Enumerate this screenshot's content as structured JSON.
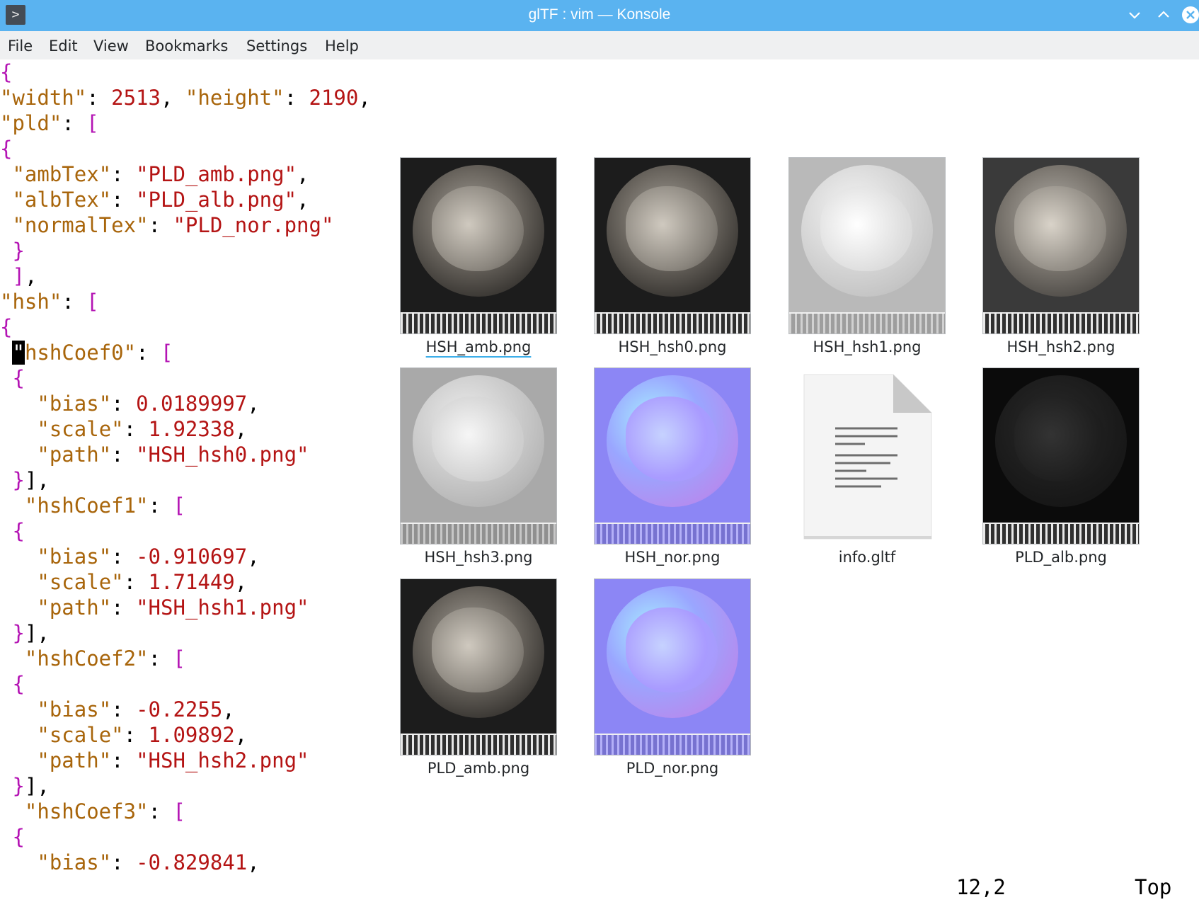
{
  "window": {
    "title": "glTF : vim — Konsole",
    "app_icon": ">",
    "buttons": [
      "minimize-icon",
      "maximize-icon",
      "close-icon"
    ]
  },
  "menu": {
    "items": [
      "File",
      "Edit",
      "View",
      "Bookmarks",
      "Settings",
      "Help"
    ]
  },
  "editor": {
    "lines": [
      [
        [
          "p",
          "{"
        ]
      ],
      [
        [
          "k",
          "\"width\""
        ],
        [
          "t",
          ": "
        ],
        [
          "n",
          "2513"
        ],
        [
          "t",
          ", "
        ],
        [
          "k",
          "\"height\""
        ],
        [
          "t",
          ": "
        ],
        [
          "n",
          "2190"
        ],
        [
          "t",
          ","
        ]
      ],
      [
        [
          "k",
          "\"pld\""
        ],
        [
          "t",
          ": "
        ],
        [
          "p",
          "["
        ]
      ],
      [
        [
          "p",
          "{"
        ]
      ],
      [
        [
          "t",
          " "
        ],
        [
          "k",
          "\"ambTex\""
        ],
        [
          "t",
          ": "
        ],
        [
          "s",
          "\"PLD_amb.png\""
        ],
        [
          "t",
          ","
        ]
      ],
      [
        [
          "t",
          " "
        ],
        [
          "k",
          "\"albTex\""
        ],
        [
          "t",
          ": "
        ],
        [
          "s",
          "\"PLD_alb.png\""
        ],
        [
          "t",
          ","
        ]
      ],
      [
        [
          "t",
          " "
        ],
        [
          "k",
          "\"normalTex\""
        ],
        [
          "t",
          ": "
        ],
        [
          "s",
          "\"PLD_nor.png\""
        ]
      ],
      [
        [
          "t",
          " "
        ],
        [
          "p",
          "}"
        ]
      ],
      [
        [
          "t",
          " "
        ],
        [
          "p",
          "]"
        ],
        [
          "t",
          ","
        ]
      ],
      [
        [
          "k",
          "\"hsh\""
        ],
        [
          "t",
          ": "
        ],
        [
          "p",
          "["
        ]
      ],
      [
        [
          "p",
          "{"
        ]
      ],
      [
        [
          "t",
          " "
        ],
        [
          "c",
          "\""
        ],
        [
          "k",
          "hshCoef0\""
        ],
        [
          "t",
          ": "
        ],
        [
          "p",
          "["
        ]
      ],
      [
        [
          "t",
          " "
        ],
        [
          "p",
          "{"
        ]
      ],
      [
        [
          "t",
          "   "
        ],
        [
          "k",
          "\"bias\""
        ],
        [
          "t",
          ": "
        ],
        [
          "n",
          "0.0189997"
        ],
        [
          "t",
          ","
        ]
      ],
      [
        [
          "t",
          "   "
        ],
        [
          "k",
          "\"scale\""
        ],
        [
          "t",
          ": "
        ],
        [
          "n",
          "1.92338"
        ],
        [
          "t",
          ","
        ]
      ],
      [
        [
          "t",
          "   "
        ],
        [
          "k",
          "\"path\""
        ],
        [
          "t",
          ": "
        ],
        [
          "s",
          "\"HSH_hsh0.png\""
        ]
      ],
      [
        [
          "t",
          " "
        ],
        [
          "p",
          "}"
        ],
        [
          "t",
          "],"
        ]
      ],
      [
        [
          "t",
          "  "
        ],
        [
          "k",
          "\"hshCoef1\""
        ],
        [
          "t",
          ": "
        ],
        [
          "p",
          "["
        ]
      ],
      [
        [
          "t",
          " "
        ],
        [
          "p",
          "{"
        ]
      ],
      [
        [
          "t",
          "   "
        ],
        [
          "k",
          "\"bias\""
        ],
        [
          "t",
          ": "
        ],
        [
          "n",
          "-0.910697"
        ],
        [
          "t",
          ","
        ]
      ],
      [
        [
          "t",
          "   "
        ],
        [
          "k",
          "\"scale\""
        ],
        [
          "t",
          ": "
        ],
        [
          "n",
          "1.71449"
        ],
        [
          "t",
          ","
        ]
      ],
      [
        [
          "t",
          "   "
        ],
        [
          "k",
          "\"path\""
        ],
        [
          "t",
          ": "
        ],
        [
          "s",
          "\"HSH_hsh1.png\""
        ]
      ],
      [
        [
          "t",
          " "
        ],
        [
          "p",
          "}"
        ],
        [
          "t",
          "],"
        ]
      ],
      [
        [
          "t",
          "  "
        ],
        [
          "k",
          "\"hshCoef2\""
        ],
        [
          "t",
          ": "
        ],
        [
          "p",
          "["
        ]
      ],
      [
        [
          "t",
          " "
        ],
        [
          "p",
          "{"
        ]
      ],
      [
        [
          "t",
          "   "
        ],
        [
          "k",
          "\"bias\""
        ],
        [
          "t",
          ": "
        ],
        [
          "n",
          "-0.2255"
        ],
        [
          "t",
          ","
        ]
      ],
      [
        [
          "t",
          "   "
        ],
        [
          "k",
          "\"scale\""
        ],
        [
          "t",
          ": "
        ],
        [
          "n",
          "1.09892"
        ],
        [
          "t",
          ","
        ]
      ],
      [
        [
          "t",
          "   "
        ],
        [
          "k",
          "\"path\""
        ],
        [
          "t",
          ": "
        ],
        [
          "s",
          "\"HSH_hsh2.png\""
        ]
      ],
      [
        [
          "t",
          " "
        ],
        [
          "p",
          "}"
        ],
        [
          "t",
          "],"
        ]
      ],
      [
        [
          "t",
          "  "
        ],
        [
          "k",
          "\"hshCoef3\""
        ],
        [
          "t",
          ": "
        ],
        [
          "p",
          "["
        ]
      ],
      [
        [
          "t",
          " "
        ],
        [
          "p",
          "{"
        ]
      ],
      [
        [
          "t",
          "   "
        ],
        [
          "k",
          "\"bias\""
        ],
        [
          "t",
          ": "
        ],
        [
          "n",
          "-0.829841"
        ],
        [
          "t",
          ","
        ]
      ]
    ],
    "status_position": "12,2",
    "status_scroll": "Top"
  },
  "files": [
    {
      "name": "HSH_amb.png",
      "kind": "photo-dark",
      "selected": true
    },
    {
      "name": "HSH_hsh0.png",
      "kind": "photo-dark",
      "selected": false
    },
    {
      "name": "HSH_hsh1.png",
      "kind": "relief-light",
      "selected": false
    },
    {
      "name": "HSH_hsh2.png",
      "kind": "photo-grey",
      "selected": false
    },
    {
      "name": "HSH_hsh3.png",
      "kind": "relief-mid",
      "selected": false
    },
    {
      "name": "HSH_nor.png",
      "kind": "normal-map",
      "selected": false
    },
    {
      "name": "info.gltf",
      "kind": "document",
      "selected": false
    },
    {
      "name": "PLD_alb.png",
      "kind": "photo-black",
      "selected": false
    },
    {
      "name": "PLD_amb.png",
      "kind": "photo-dark",
      "selected": false
    },
    {
      "name": "PLD_nor.png",
      "kind": "normal-map",
      "selected": false
    }
  ],
  "colors": {
    "titlebar": "#5ab3f0",
    "menubar": "#eff0f1",
    "json_punct": "#b414b4",
    "json_key": "#a8650b",
    "json_value": "#b41414",
    "selection_underline": "#3daee9"
  }
}
